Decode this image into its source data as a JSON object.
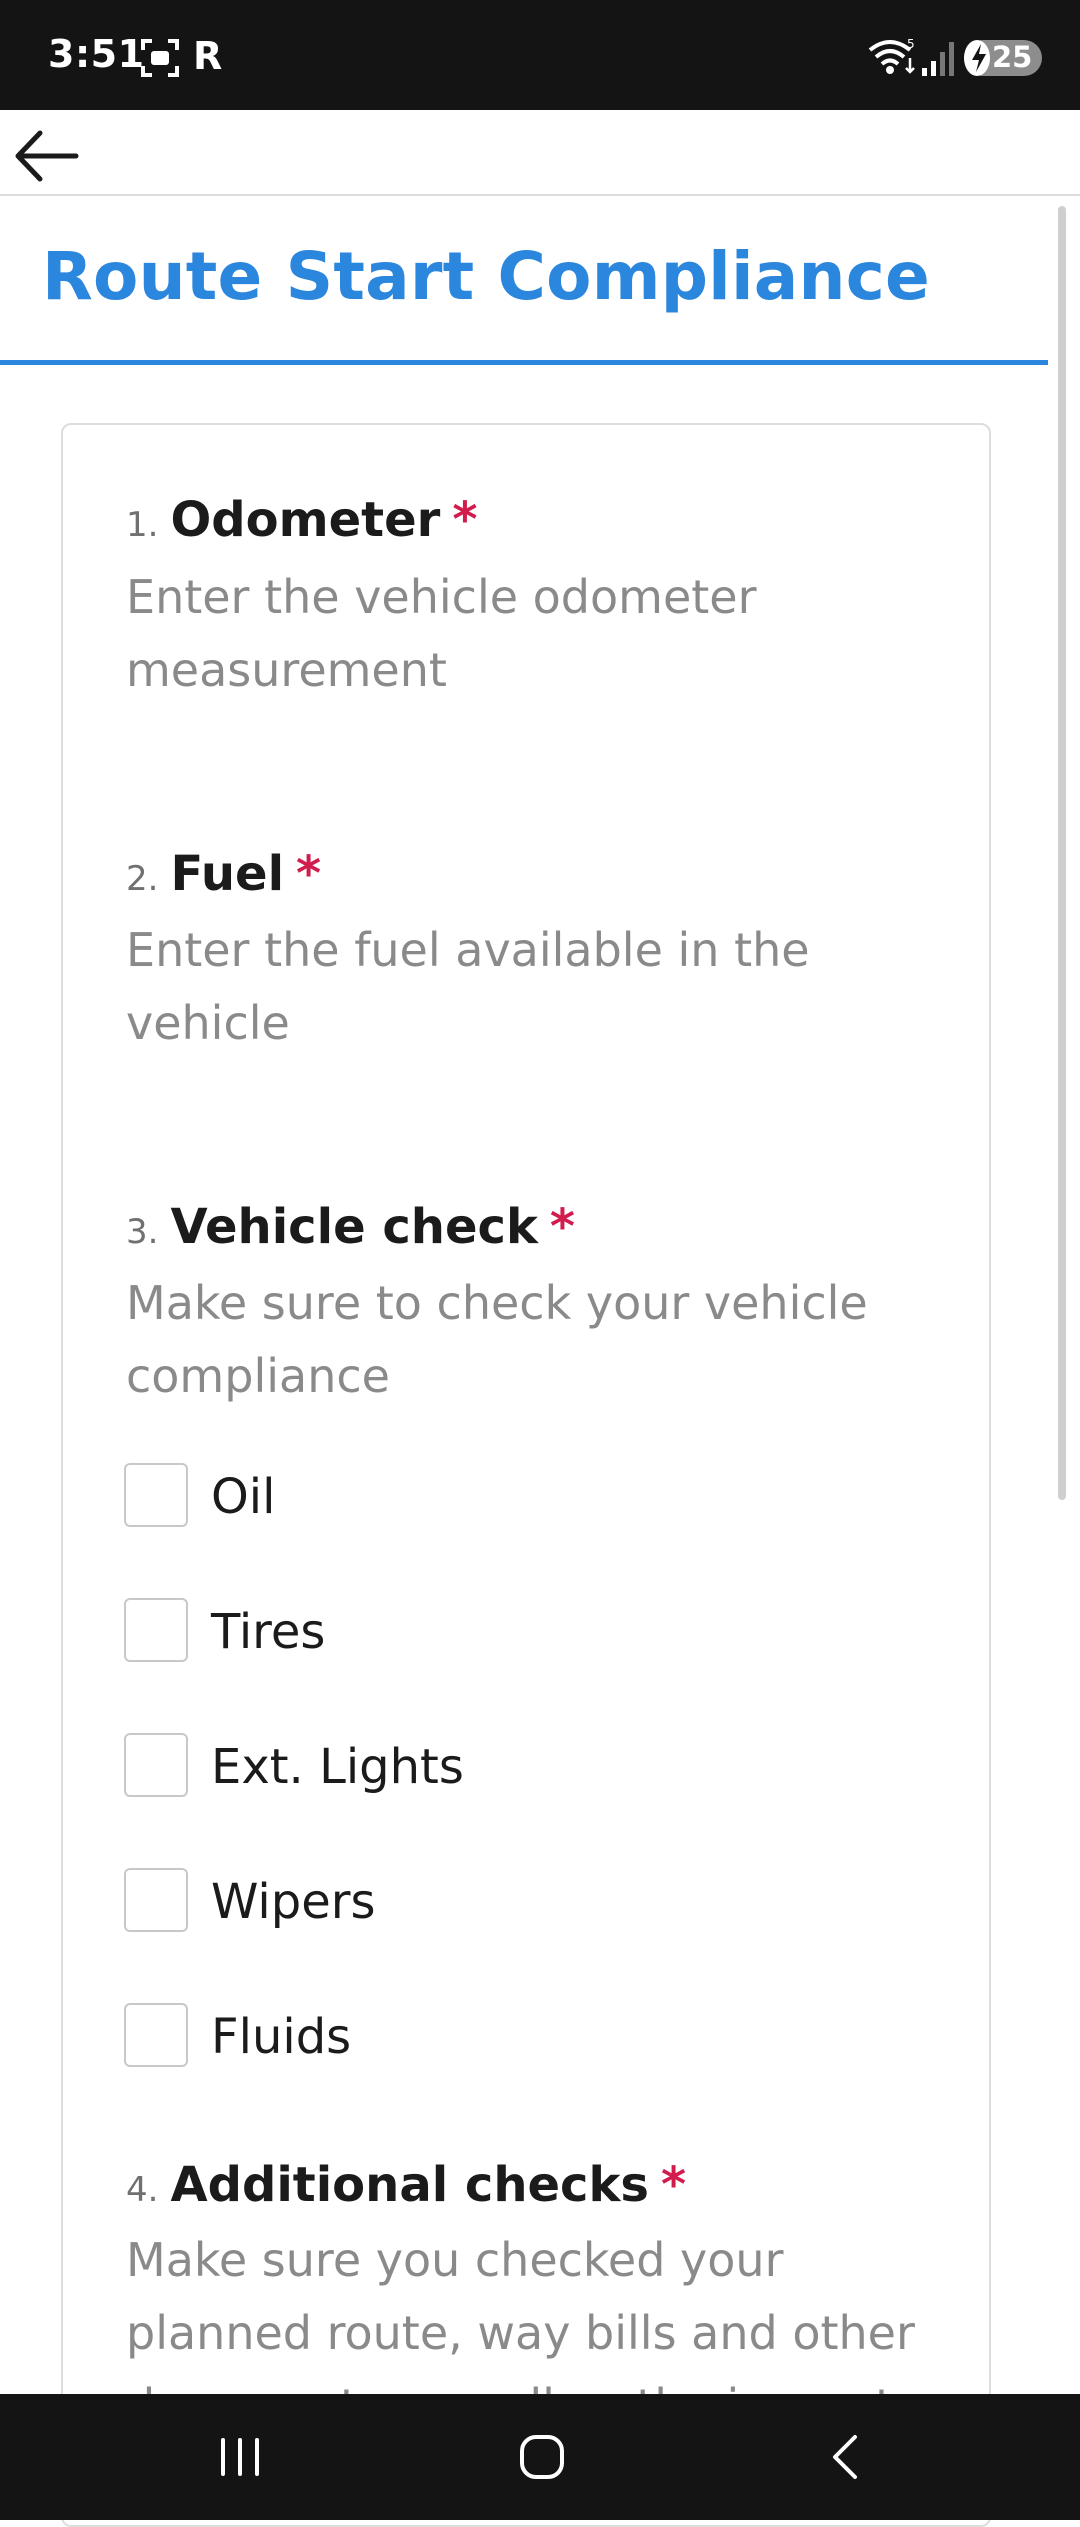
{
  "status_bar": {
    "time": "3:51",
    "carrier_icon_text": "R",
    "battery_level": "25"
  },
  "toolbar": {
    "back_icon": "arrow-left-icon"
  },
  "page": {
    "title": "Route Start Compliance"
  },
  "questions": [
    {
      "number": "1.",
      "title": "Odometer",
      "required_mark": "*",
      "description": "Enter the vehicle odometer measurement"
    },
    {
      "number": "2.",
      "title": "Fuel",
      "required_mark": "*",
      "description": "Enter the fuel available in the vehicle"
    },
    {
      "number": "3.",
      "title": "Vehicle check",
      "required_mark": "*",
      "description": "Make sure to check your vehicle compliance",
      "options": [
        "Oil",
        "Tires",
        "Ext. Lights",
        "Wipers",
        "Fluids"
      ]
    },
    {
      "number": "4.",
      "title": "Additional checks",
      "required_mark": "*",
      "description": "Make sure you checked your planned route, way bills and other documents as well as the inspect"
    }
  ],
  "nav_bar": {
    "recents_icon": "recents-icon",
    "home_icon": "home-icon",
    "back_icon": "back-chevron-icon"
  },
  "colors": {
    "accent": "#2b86dd",
    "required": "#d31c4e",
    "status_bar": "#141414"
  }
}
